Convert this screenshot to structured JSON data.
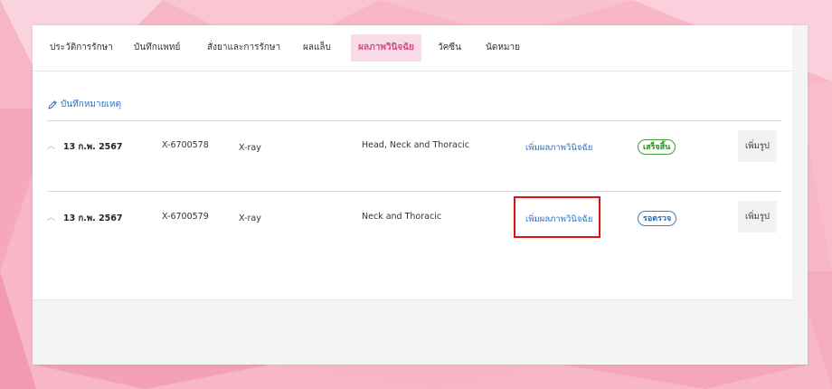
{
  "tabs": [
    {
      "label": "ประวัติการรักษา",
      "active": false
    },
    {
      "label": "บันทึกแพทย์",
      "active": false
    },
    {
      "label": "สั่งยาและการรักษา",
      "active": false
    },
    {
      "label": "ผลแล็บ",
      "active": false
    },
    {
      "label": "ผลภาพวินิจฉัย",
      "active": true
    },
    {
      "label": "วัคซีน",
      "active": false
    },
    {
      "label": "นัดหมาย",
      "active": false
    }
  ],
  "note_link": {
    "label": "บันทึกหมายเหตุ",
    "icon": "pencil-icon"
  },
  "rows": [
    {
      "date": "13 ก.พ. 2567",
      "code": "X-6700578",
      "modality": "X-ray",
      "region": "Head, Neck and Thoracic",
      "action_link": "เพิ่มผลภาพวินิจฉัย",
      "status": "เสร็จสิ้น",
      "status_color": "#2f8a2b",
      "add_image_button": "เพิ่มรูป"
    },
    {
      "date": "13 ก.พ. 2567",
      "code": "X-6700579",
      "modality": "X-ray",
      "region": "Neck and Thoracic",
      "action_link": "เพิ่มผลภาพวินิจฉัย",
      "status": "รอตรวจ",
      "status_color": "#2a6fb8",
      "add_image_button": "เพิ่มรูป"
    }
  ],
  "colors": {
    "active_tab_text": "#d04f86",
    "active_tab_bg": "#f8dbe6",
    "link": "#2a72c2",
    "highlight": "#dd1111"
  }
}
